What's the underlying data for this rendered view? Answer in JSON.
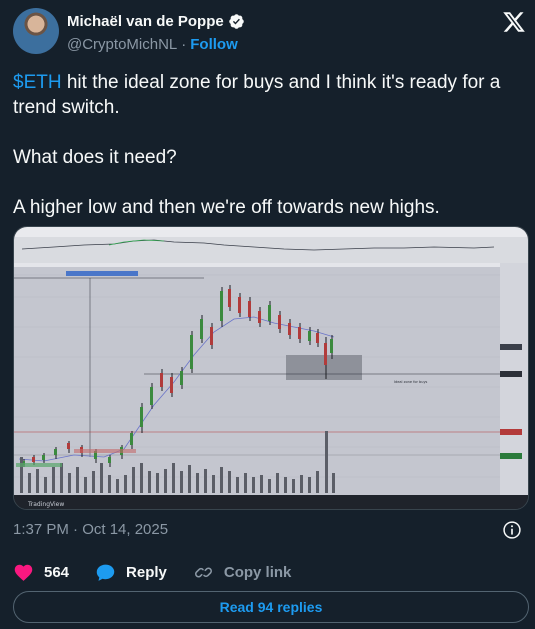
{
  "author": {
    "name": "Michaël van de Poppe",
    "handle": "@CryptoMichNL",
    "separator": "·",
    "follow_label": "Follow"
  },
  "tweet": {
    "cashtag": "$ETH",
    "line1_rest": " hit the ideal zone for buys and I think it's ready for a trend switch.",
    "line2": "What does it need?",
    "line3": "A higher low and then we're off towards new highs."
  },
  "chart_image": {
    "annotation": "Ideal zone for buys",
    "footer_brand": "TradingView"
  },
  "meta": {
    "timestamp": "1:37 PM · Oct 14, 2025"
  },
  "actions": {
    "likes": "564",
    "reply_label": "Reply",
    "copy_label": "Copy link"
  },
  "read_replies_label": "Read 94 replies",
  "colors": {
    "background": "#15202b",
    "accent": "#1d9bf0",
    "like": "#f91880",
    "muted": "#8b98a5"
  }
}
